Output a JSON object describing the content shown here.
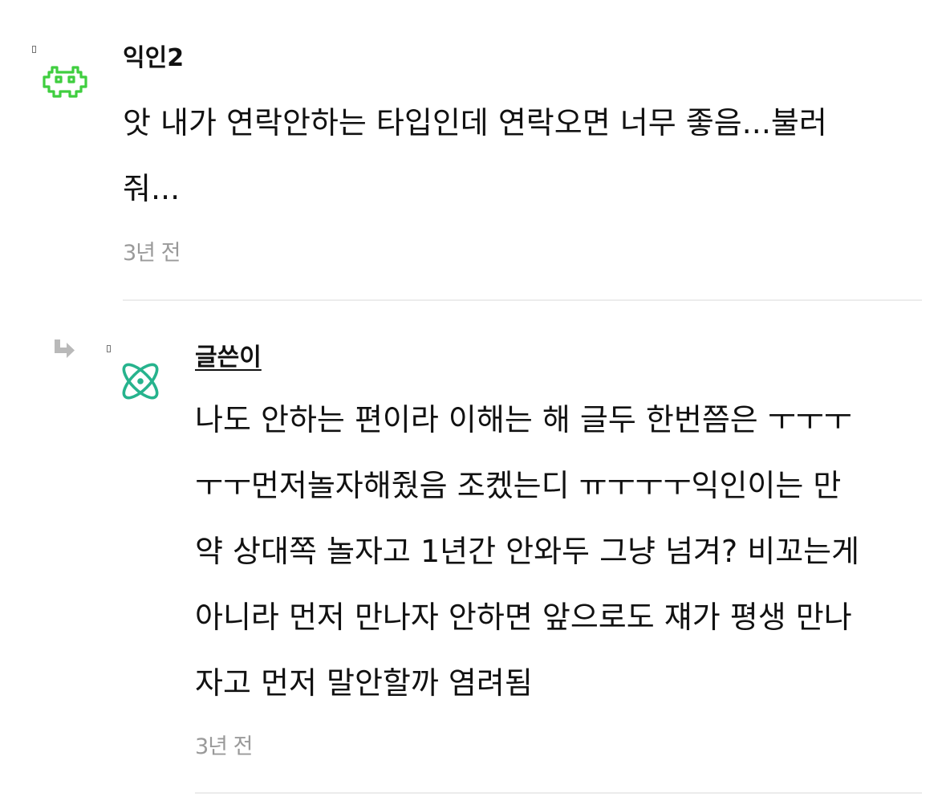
{
  "comments": [
    {
      "author": "익인2",
      "avatar_icon": "space-invader-icon",
      "avatar_color": "#3fce3f",
      "body_lines": [
        "앗 내가 연락안하는 타입인데 연락오면 너무 좋음...불러",
        "줘..."
      ],
      "time": "3년 전"
    },
    {
      "author": "글쓴이",
      "avatar_icon": "atom-icon",
      "avatar_color": "#26b38d",
      "reply_icon": "reply-arrow-icon",
      "body_lines": [
        "나도 안하는 편이라 이해는 해 글두 한번쯤은 ㅜㅜㅜ",
        "ㅜㅜ먼저놀자해줬음 조켔는디 ㅠㅜㅜㅜ익인이는 만",
        "약 상대쪽 놀자고 1년간 안와두 그냥 넘겨? 비꼬는게",
        "아니라 먼저 만나자 안하면 앞으로도 쟤가 평생 만나",
        "자고 먼저 말안할까 염려됨"
      ],
      "time": "3년 전"
    }
  ]
}
